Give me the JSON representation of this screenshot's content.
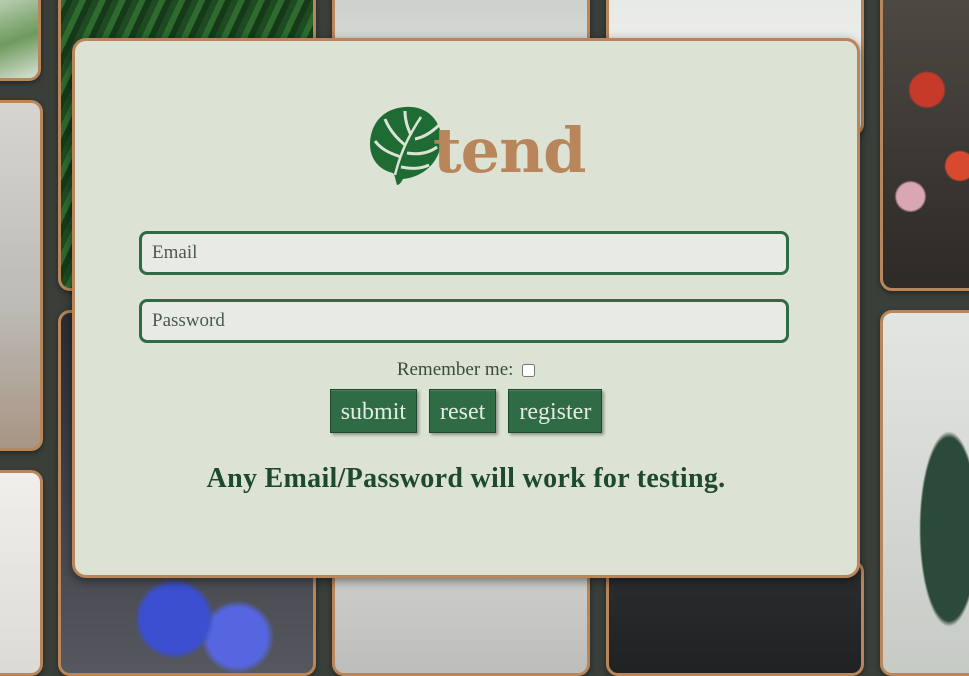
{
  "brand": {
    "name": "tend",
    "leaf_color": "#1f6b34",
    "text_color": "#b8865a"
  },
  "login": {
    "email_placeholder": "Email",
    "password_placeholder": "Password",
    "remember_label": "Remember me:",
    "remember_checked": false,
    "submit_label": "submit",
    "reset_label": "reset",
    "register_label": "register",
    "note": "Any Email/Password will work for testing."
  },
  "background": {
    "gallery_description": "grid of plant photo tiles",
    "accent_border": "#b8865a"
  }
}
